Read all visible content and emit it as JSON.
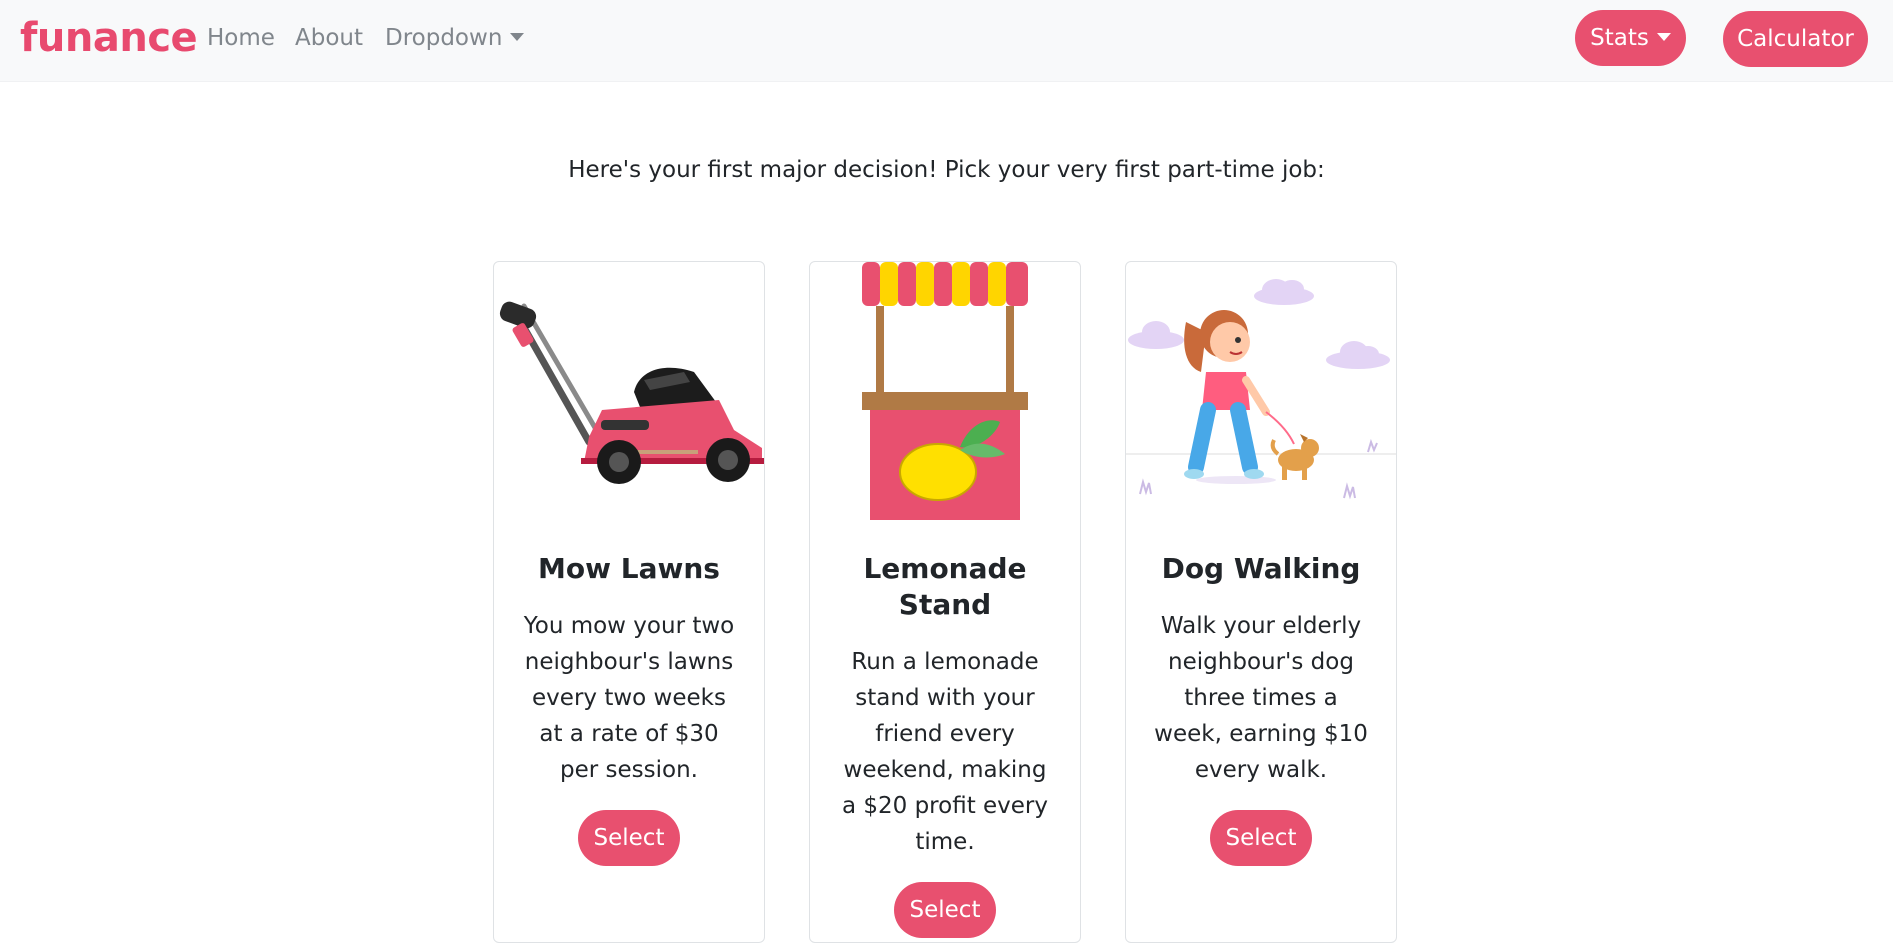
{
  "navbar": {
    "brand": "funance",
    "links": [
      "Home",
      "About",
      "Dropdown"
    ],
    "stats_label": "Stats",
    "calculator_label": "Calculator"
  },
  "intro": "Here's your first major decision! Pick your very first part-time job:",
  "cards": [
    {
      "title": "Mow Lawns",
      "text": "You mow your two neighbour's lawns every two weeks at a rate of $30 per session.",
      "button": "Select",
      "image_icon": "lawn-mower-icon"
    },
    {
      "title": "Lemonade Stand",
      "text": "Run a lemonade stand with your friend every weekend, making a $20 profit every time.",
      "button": "Select",
      "image_icon": "lemonade-stand-icon"
    },
    {
      "title": "Dog Walking",
      "text": "Walk your elderly neighbour's dog three times a week, earning $10 every walk.",
      "button": "Select",
      "image_icon": "dog-walking-icon"
    }
  ],
  "colors": {
    "accent": "#e8506f",
    "navbar_bg": "#f8f9fa",
    "nav_link": "#80868c"
  }
}
